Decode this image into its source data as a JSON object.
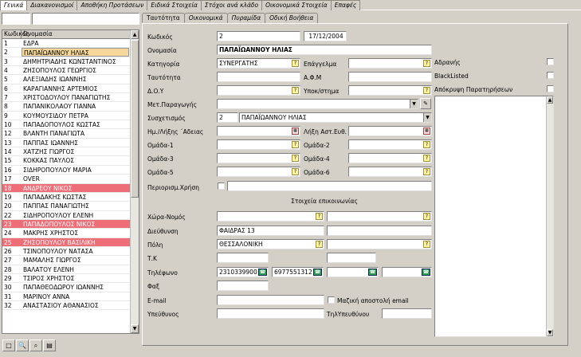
{
  "main_tabs": [
    "Γενικά",
    "Διακανονισμοί",
    "Αποθήκη Προτάσεων",
    "Ειδικά Στοιχεία",
    "Στόχοι ανά κλάδο",
    "Οικονομικά Στοιχεία",
    "Επαφές"
  ],
  "sub_tabs": [
    "Ταυτότητα",
    "Οικονομικά",
    "Πυραμίδα",
    "Οδική Βοήθεια"
  ],
  "grid": {
    "col_code": "Κωδικός",
    "col_name": "Ονομασία",
    "rows": [
      {
        "code": "1",
        "name": "ΕΔΡΑ",
        "state": ""
      },
      {
        "code": "2",
        "name": "ΠΑΠΑΪΩΑΝΝΟΥ ΗΛΙΑΣ",
        "state": "sel"
      },
      {
        "code": "3",
        "name": "ΔΗΜΗΤΡΙΑΔΗΣ ΚΩΝΣΤΑΝΤΙΝΟΣ",
        "state": ""
      },
      {
        "code": "4",
        "name": "ΖΗΣΟΠΟΥΛΟΣ ΓΕΩΡΓΙΟΣ",
        "state": ""
      },
      {
        "code": "5",
        "name": "ΑΛΕΞΙΑΔΗΣ ΙΩΑΝΝΗΣ",
        "state": ""
      },
      {
        "code": "6",
        "name": "ΚΑΡΑΓΙΑΝΝΗΣ ΑΡΤΕΜΙΟΣ",
        "state": ""
      },
      {
        "code": "7",
        "name": "ΧΡΙΣΤΟΔΟΥΛΟΥ ΠΑΝΑΓΙΩΤΗΣ",
        "state": ""
      },
      {
        "code": "8",
        "name": "ΠΑΠΑΝΙΚΟΛΑΟΥ ΓΙΑΝΝΑ",
        "state": ""
      },
      {
        "code": "9",
        "name": "ΚΟΥΜΟΥΣΙΔΟΥ ΠΕΤΡΑ",
        "state": ""
      },
      {
        "code": "10",
        "name": "ΠΑΠΑΔΟΠΟΥΛΟΣ ΚΩΣΤΑΣ",
        "state": ""
      },
      {
        "code": "12",
        "name": "ΒΛΑΝΤΗ ΠΑΝΑΓΙΩΤΑ",
        "state": ""
      },
      {
        "code": "13",
        "name": "ΠΑΠΠΑΣ ΙΩΑΝΝΗΣ",
        "state": ""
      },
      {
        "code": "14",
        "name": "ΧΑΤΖΗΣ ΓΙΩΡΓΟΣ",
        "state": ""
      },
      {
        "code": "15",
        "name": "ΚΟΚΚΑΣ ΠΑΥΛΟΣ",
        "state": ""
      },
      {
        "code": "16",
        "name": "ΣΙΔΗΡΟΠΟΥΛΟΥ ΜΑΡΙΑ",
        "state": ""
      },
      {
        "code": "17",
        "name": "OVER",
        "state": ""
      },
      {
        "code": "18",
        "name": "ΑΝΔΡΕΟΥ ΝΙΚΟΣ",
        "state": "red"
      },
      {
        "code": "19",
        "name": "ΠΑΠΑΔΑΚΗΣ ΚΩΣΤΑΣ",
        "state": ""
      },
      {
        "code": "20",
        "name": "ΠΑΠΠΑΣ ΠΑΝΑΓΙΩΤΗΣ",
        "state": ""
      },
      {
        "code": "22",
        "name": "ΣΙΔΗΡΟΠΟΥΛΟΥ ΕΛΕΝΗ",
        "state": ""
      },
      {
        "code": "23",
        "name": "ΠΑΠΑΔΟΠΟΥΛΟΣ ΝΙΚΟΣ",
        "state": "red"
      },
      {
        "code": "24",
        "name": "ΜΑΚΡΗΣ ΧΡΗΣΤΟΣ",
        "state": ""
      },
      {
        "code": "25",
        "name": "ΖΗΣΟΠΟΥΛΟΥ ΒΑΣΙΛΙΚΗ",
        "state": "red"
      },
      {
        "code": "26",
        "name": "ΤΣΙΝΟΠΟΥΛΟΥ ΝΑΤΑΣΑ",
        "state": ""
      },
      {
        "code": "27",
        "name": "ΜΑΜΑΛΗΣ ΓΙΩΡΓΟΣ",
        "state": ""
      },
      {
        "code": "28",
        "name": "ΒΑΛΑΤΟΥ ΕΛΕΝΗ",
        "state": ""
      },
      {
        "code": "29",
        "name": "ΤΣΙΡΟΣ ΧΡΗΣΤΟΣ",
        "state": ""
      },
      {
        "code": "30",
        "name": "ΠΑΠΑΘΕΟΔΩΡΟΥ ΙΩΑΝΝΗΣ",
        "state": ""
      },
      {
        "code": "31",
        "name": "ΜΑΡΙΝΟΥ ΑΝΝΑ",
        "state": ""
      },
      {
        "code": "32",
        "name": "ΑΝΑΣΤΑΣΙΟΥ ΑΘΑΝΑΣΙΟΣ",
        "state": ""
      }
    ]
  },
  "form": {
    "code_label": "Κωδικός",
    "code_value": "2",
    "date_value": "17/12/2004",
    "name_label": "Ονομασία",
    "name_value": "ΠΑΠΑΪΩΑΝΝΟΥ ΗΛΙΑΣ",
    "category_label": "Κατηγορία",
    "category_value": "ΣΥΝΕΡΓΑΤΗΣ",
    "profession_label": "Επάγγελμα",
    "id_label": "Ταυτότητα",
    "afm_label": "Α.Φ.Μ",
    "doy_label": "Δ.Ο.Υ",
    "branch_label": "Υποκ/στημα",
    "producer_label": "Μετ.Παραγωγής",
    "partner_label": "Συσχετισμός",
    "partner_code": "2",
    "partner_name": "ΠΑΠΑΪΩΑΝΝΟΥ ΗΛΙΑΣ",
    "license_label": "Ημ./Λήξης ΄Αδειας",
    "insurance_label": "Λήξη Αστ.Ευθ.",
    "group1": "Ομάδα-1",
    "group2": "Ομάδα-2",
    "group3": "Ομάδα-3",
    "group4": "Ομάδα-4",
    "group5": "Ομάδα-5",
    "group6": "Ομάδα-6",
    "restricted_label": "Περιορισμ.Χρήση",
    "contact_section": "Στοιχεία επικοινωνίας",
    "country_label": "Χώρα-Νομός",
    "address_label": "Διεύθυνση",
    "address_value": "ΦΑΙΔΡΑΣ 13",
    "city_label": "Πόλη",
    "city_value": "ΘΕΣΣΑΛΟΝΙΚΗ",
    "zip_label": "Τ.Κ",
    "phone_label": "Τηλέφωνο",
    "phone1": "2310339900",
    "phone2": "6977551312",
    "fax_label": "Φαξ",
    "email_label": "E-mail",
    "bulk_email_label": "Μαζική αποστολή email",
    "manager_label": "Υπεύθυνος",
    "manager_phone_label": "ΤηλΥπευθύνου",
    "inactive_label": "Αδρανής",
    "blacklisted_label": "BlackListed",
    "hide_notes_label": "Απόκρυψη Παρατηρήσεων"
  }
}
